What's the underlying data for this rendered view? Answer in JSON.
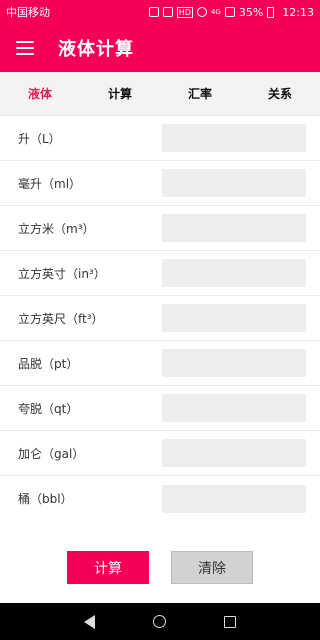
{
  "status_bar": {
    "carrier": "中国移动",
    "hd": "HD",
    "network": "4G",
    "battery": "35%",
    "time": "12:13"
  },
  "app_bar": {
    "title": "液体计算"
  },
  "tabs": [
    {
      "label": "液体",
      "active": true
    },
    {
      "label": "计算",
      "active": false
    },
    {
      "label": "汇率",
      "active": false
    },
    {
      "label": "关系",
      "active": false
    }
  ],
  "units": [
    {
      "label": "升（L）",
      "value": ""
    },
    {
      "label": "毫升（ml）",
      "value": ""
    },
    {
      "label": "立方米（m³）",
      "value": ""
    },
    {
      "label": "立方英寸（in³）",
      "value": ""
    },
    {
      "label": "立方英尺（ft³）",
      "value": ""
    },
    {
      "label": "品脱（pt）",
      "value": ""
    },
    {
      "label": "夸脱（qt）",
      "value": ""
    },
    {
      "label": "加仑（gal）",
      "value": ""
    },
    {
      "label": "桶（bbl）",
      "value": ""
    }
  ],
  "buttons": {
    "calculate": "计算",
    "clear": "清除"
  },
  "colors": {
    "accent": "#f50057",
    "active_tab": "#e0205a"
  }
}
